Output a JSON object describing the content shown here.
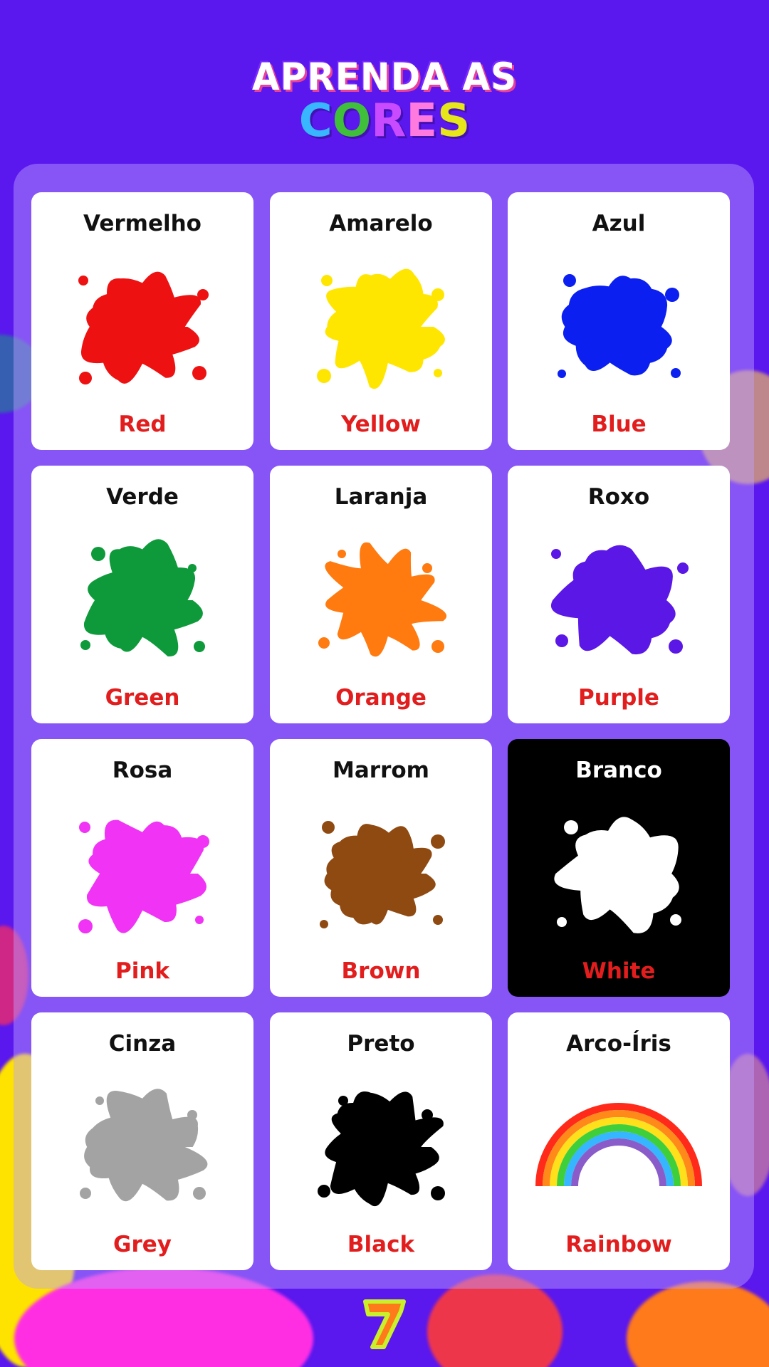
{
  "title": {
    "line1": "APRENDA AS",
    "line2_letters": [
      {
        "char": "C",
        "color": "#38b6ff"
      },
      {
        "char": "O",
        "color": "#3fbf3a"
      },
      {
        "char": "R",
        "color": "#c84bff"
      },
      {
        "char": "E",
        "color": "#ff7adf"
      },
      {
        "char": "S",
        "color": "#e6e61a"
      }
    ]
  },
  "cards": [
    {
      "pt": "Vermelho",
      "en": "Red",
      "color": "#ee1111",
      "icon": "red-paint-splat-icon"
    },
    {
      "pt": "Amarelo",
      "en": "Yellow",
      "color": "#ffe600",
      "icon": "yellow-paint-splat-icon"
    },
    {
      "pt": "Azul",
      "en": "Blue",
      "color": "#0b1ff0",
      "icon": "blue-paint-splat-icon"
    },
    {
      "pt": "Verde",
      "en": "Green",
      "color": "#0e9a3a",
      "icon": "green-paint-splat-icon"
    },
    {
      "pt": "Laranja",
      "en": "Orange",
      "color": "#ff7a0f",
      "icon": "orange-paint-splat-icon"
    },
    {
      "pt": "Roxo",
      "en": "Purple",
      "color": "#5a17e6",
      "icon": "purple-paint-splat-icon"
    },
    {
      "pt": "Rosa",
      "en": "Pink",
      "color": "#f033f5",
      "icon": "pink-paint-splat-icon"
    },
    {
      "pt": "Marrom",
      "en": "Brown",
      "color": "#8f4a12",
      "icon": "brown-paint-splat-icon"
    },
    {
      "pt": "Branco",
      "en": "White",
      "color": "#ffffff",
      "icon": "white-paint-splat-icon"
    },
    {
      "pt": "Cinza",
      "en": "Grey",
      "color": "#a3a3a3",
      "icon": "grey-paint-splat-icon"
    },
    {
      "pt": "Preto",
      "en": "Black",
      "color": "#000000",
      "icon": "black-paint-splat-icon"
    },
    {
      "pt": "Arco-Íris",
      "en": "Rainbow",
      "color": "rainbow",
      "icon": "rainbow-icon"
    }
  ],
  "colors": {
    "background": "#5a17ee",
    "label_red": "#e21d1d"
  }
}
